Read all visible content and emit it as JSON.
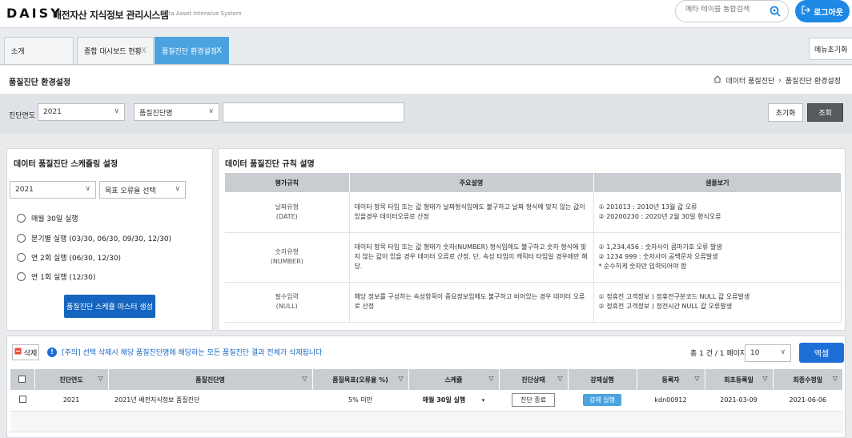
{
  "header": {
    "logo": "DAISY",
    "system_name": "배전자산 지식정보 관리시스템",
    "system_subtitle": "Data Asset Intensive System",
    "search_placeholder": "메타 테이블 통합검색",
    "logout_label": "로그아웃"
  },
  "tabs": [
    {
      "label": "소개"
    },
    {
      "label": "종합 대시보드 현황",
      "close": "X"
    },
    {
      "label": "품질진단 환경설정",
      "close": "X"
    }
  ],
  "menu_init_label": "메뉴초기화",
  "page": {
    "title": "품질진단 환경설정",
    "breadcrumb": [
      "데이터 품질진단",
      "품질진단 환경설정"
    ]
  },
  "filter": {
    "year_label": "진단연도",
    "year_value": "2021",
    "name_select": "품질진단명",
    "name_input": "",
    "reset_label": "초기화",
    "search_label": "조회"
  },
  "schedule_panel": {
    "title": "데이터 품질진단 스케쥴링 설정",
    "year_value": "2021",
    "target_select": "목표 오류율 선택",
    "options": [
      "매월 30일 실행",
      "분기별 실행 (03/30, 06/30, 09/30, 12/30)",
      "연 2회 실행 (06/30, 12/30)",
      "연 1회 실행 (12/30)"
    ],
    "create_button": "품질진단 스케쥴 마스터 생성"
  },
  "rules_panel": {
    "title": "데이터 품질진단 규칙 설명",
    "columns": [
      "평가규칙",
      "주요설명",
      "샘플보기"
    ],
    "rows": [
      {
        "rule": [
          "날짜유형",
          "(DATE)"
        ],
        "desc": "데이터 항목 타입 또는 값 형태가 날짜형식임에도 불구하고 날짜 형식에 맞지 않는 값이 있을경우 데이터오류로 산정",
        "samples": [
          "① 201013 : 2010년 13월 값 오류",
          "② 20200230 : 2020년 2월 30일 형식오류"
        ]
      },
      {
        "rule": [
          "숫자유형",
          "(NUMBER)"
        ],
        "desc": "데이터 항목 타입 또는 값 형태가 숫자(NUMBER) 형식임에도 불구하고 숫자 형식에 맞지 않는 값이 있을 경우 데이터 오류로 산정. 단, 속성 타입이 캐릭터 타입일 경우에만 해당.",
        "samples": [
          "① 1,234,456 : 숫자사이 콤마기호 오류 발생",
          "② 1234 999 : 숫자사이 공백문자 오류발생",
          "* 순수하게 숫자만 입력되어야 함"
        ]
      },
      {
        "rule": [
          "필수입력",
          "(NULL)"
        ],
        "desc": "해당 정보를 구성하는 속성항목이 중요정보임에도 불구하고 비어있는 경우 데이터 오류로 산정",
        "samples": [
          "① 정휴전 고객정보 ) 정휴전구분코드 NULL 값 오류발생",
          "② 정휴전 고객정보 ) 정전시간 NULL 값 오류발생"
        ]
      }
    ]
  },
  "grid": {
    "delete_label": "삭제",
    "notice": "[주의] 선택 삭제시 해당 품질진단명에 해당하는 모든 품질진단 결과 전체가 삭제됩니다",
    "count_text": "총 1 건 / 1 페이지",
    "page_size": "10",
    "excel_label": "엑셀",
    "columns": [
      "진단연도",
      "품질진단명",
      "품질목표(오류율 %)",
      "스케쥴",
      "진단상태",
      "강제실행",
      "등록자",
      "최초등록일",
      "최종수정일"
    ],
    "rows": [
      {
        "year": "2021",
        "name": "2021년 배전지식정보 품질진단",
        "target": "5% 미만",
        "schedule": "매월 30일 실행",
        "status": "진단 종료",
        "force": "강제 실행",
        "registrant": "kdn00912",
        "created": "2021-03-09",
        "modified": "2021-06-06"
      }
    ]
  }
}
